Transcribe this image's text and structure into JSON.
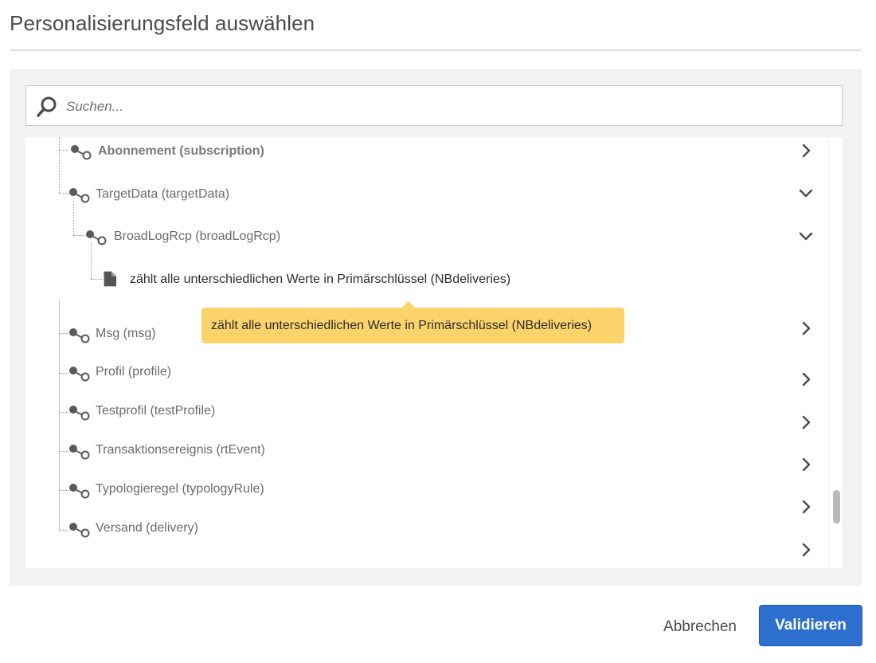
{
  "dialog": {
    "title": "Personalisierungsfeld auswählen"
  },
  "search": {
    "placeholder": "Suchen..."
  },
  "tree": {
    "items": [
      {
        "label": "Abonnement (subscription)",
        "icon": "link-icon",
        "expanded": false
      },
      {
        "label": "TargetData (targetData)",
        "icon": "link-icon",
        "expanded": true
      },
      {
        "label": "BroadLogRcp (broadLogRcp)",
        "icon": "link-icon",
        "expanded": true
      },
      {
        "label": "zählt alle unterschiedlichen Werte in Primärschlüssel (NBdeliveries)",
        "icon": "document-icon"
      },
      {
        "label": "Msg (msg)",
        "icon": "link-icon",
        "expanded": false
      },
      {
        "label": "Profil (profile)",
        "icon": "link-icon",
        "expanded": false
      },
      {
        "label": "Testprofil (testProfile)",
        "icon": "link-icon",
        "expanded": false
      },
      {
        "label": "Transaktionsereignis (rtEvent)",
        "icon": "link-icon",
        "expanded": false
      },
      {
        "label": "Typologieregel (typologyRule)",
        "icon": "link-icon",
        "expanded": false
      },
      {
        "label": "Versand (delivery)",
        "icon": "link-icon",
        "expanded": false
      }
    ]
  },
  "tooltip": {
    "text": "zählt alle unterschiedlichen Werte in Primärschlüssel (NBdeliveries)"
  },
  "footer": {
    "cancel_label": "Abbrechen",
    "validate_label": "Validieren"
  },
  "colors": {
    "primary_button": "#2d6fce",
    "tooltip_background": "#fbd36b",
    "panel_background": "#f2f2f2"
  }
}
